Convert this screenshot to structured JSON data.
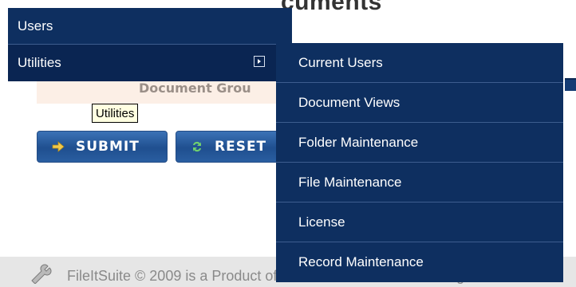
{
  "page": {
    "heading_fragment": "cuments",
    "hint_text": "Document Grou",
    "submit_label": "SUBMIT",
    "reset_label": "RESET",
    "footer_text": "FileItSuite © 2009 is a Product of MarkWebs.com LLC - All Rights R"
  },
  "tooltip": {
    "text": "Utilities"
  },
  "menu": {
    "items": [
      {
        "label": "Users"
      },
      {
        "label": "Utilities",
        "has_submenu": true
      }
    ]
  },
  "submenu": {
    "items": [
      {
        "label": "Current Users"
      },
      {
        "label": "Document Views"
      },
      {
        "label": "Folder Maintenance"
      },
      {
        "label": "File Maintenance"
      },
      {
        "label": "License"
      },
      {
        "label": "Record Maintenance"
      }
    ]
  },
  "colors": {
    "menu_bg": "#0e2f60",
    "button_blue": "#1f4f8f",
    "tooltip_bg": "#ffffe1",
    "footer_bg": "#e6e6e6"
  },
  "icons": {
    "submenu_indicator": "chevron-right-icon",
    "submit": "arrow-right-icon",
    "reset": "refresh-icon",
    "footer": "wrench-icon"
  }
}
